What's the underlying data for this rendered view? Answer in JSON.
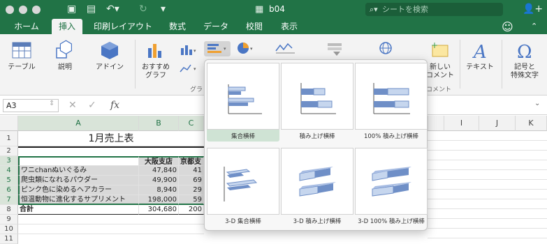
{
  "window": {
    "title": "b04"
  },
  "search": {
    "placeholder": "シートを検索"
  },
  "tabs": [
    {
      "label": "ホーム",
      "active": false
    },
    {
      "label": "挿入",
      "active": true
    },
    {
      "label": "印刷レイアウト",
      "active": false
    },
    {
      "label": "数式",
      "active": false
    },
    {
      "label": "データ",
      "active": false
    },
    {
      "label": "校閲",
      "active": false
    },
    {
      "label": "表示",
      "active": false
    }
  ],
  "ribbon": {
    "table": "テーブル",
    "illustrations": "説明",
    "addins": "アドイン",
    "recommended_1": "おすすめ",
    "recommended_2": "グラフ",
    "group_chart": "グラ",
    "comment_1": "新しい",
    "comment_2": "コメント",
    "group_comment": "コメント",
    "text": "テキスト",
    "symbols_1": "記号と",
    "symbols_2": "特殊文字"
  },
  "formula_bar": {
    "name_box": "A3",
    "fx": "fx"
  },
  "columns": [
    "A",
    "B",
    "C",
    "I",
    "J",
    "K"
  ],
  "rows": [
    "1",
    "2",
    "3",
    "4",
    "5",
    "6",
    "7",
    "8",
    "9",
    "10",
    "11"
  ],
  "sheet": {
    "title": "1月売上表",
    "headers": [
      "大阪支店",
      "京都支"
    ],
    "items": [
      {
        "name": "ワニchanぬいぐるみ",
        "osaka": "47,840",
        "kyoto": "41"
      },
      {
        "name": "爬虫類になれるパウダー",
        "osaka": "49,900",
        "kyoto": "69"
      },
      {
        "name": "ピンク色に染めるヘアカラー",
        "osaka": "8,940",
        "kyoto": "29"
      },
      {
        "name": "恒温動物に進化するサプリメント",
        "osaka": "198,000",
        "kyoto": "59"
      }
    ],
    "total": {
      "name": "合計",
      "osaka": "304,680",
      "kyoto": "200"
    }
  },
  "chart_options": [
    {
      "label": "集合横棒",
      "selected": true
    },
    {
      "label": "積み上げ横棒",
      "selected": false
    },
    {
      "label": "100% 積み上げ横棒",
      "selected": false
    },
    {
      "label": "3-D 集合横棒",
      "selected": false
    },
    {
      "label": "3-D 積み上げ横棒",
      "selected": false
    },
    {
      "label": "3-D 100% 積み上げ横棒",
      "selected": false
    }
  ],
  "colors": {
    "accent": "#217346",
    "bar_dark": "#6f8fc7",
    "bar_light": "#c6d6ee"
  }
}
